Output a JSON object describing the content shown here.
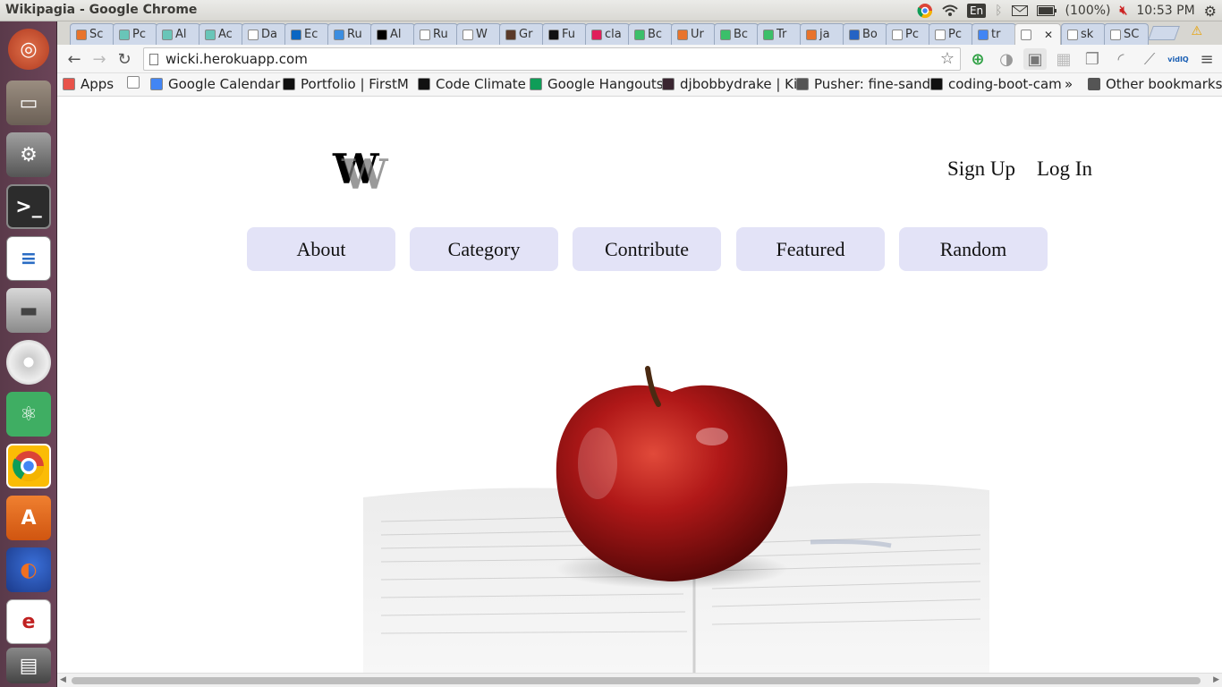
{
  "os": {
    "window_title": "Wikipagia - Google Chrome",
    "keyboard_lang": "En",
    "battery": "(100%)",
    "clock": "10:53 PM",
    "launcher_icons": [
      "ubuntu-dash-icon",
      "files-icon",
      "system-settings-icon",
      "terminal-icon",
      "libreoffice-writer-icon",
      "disk-icon",
      "dvd-icon",
      "atom-editor-icon",
      "chrome-icon",
      "software-center-icon",
      "firefox-icon",
      "document-viewer-icon",
      "trash-icon"
    ]
  },
  "tabs": [
    {
      "label": "Sc",
      "fav": "#e8732c"
    },
    {
      "label": "Pc",
      "fav": "#69c5b8"
    },
    {
      "label": "Al",
      "fav": "#69c5b8"
    },
    {
      "label": "Ac",
      "fav": "#69c5b8"
    },
    {
      "label": "Da",
      "fav": "#ffffff"
    },
    {
      "label": "Ec",
      "fav": "#0a66c2"
    },
    {
      "label": "Ru",
      "fav": "#3b8de0"
    },
    {
      "label": "Al",
      "fav": "#000000"
    },
    {
      "label": "Ru",
      "fav": "#ffffff"
    },
    {
      "label": "W",
      "fav": "#ffffff"
    },
    {
      "label": "Gr",
      "fav": "#5a3a2a"
    },
    {
      "label": "Fu",
      "fav": "#111111"
    },
    {
      "label": "cla",
      "fav": "#e01e5a"
    },
    {
      "label": "Bc",
      "fav": "#3bbf6a"
    },
    {
      "label": "Ur",
      "fav": "#e8732c"
    },
    {
      "label": "Bc",
      "fav": "#3bbf6a"
    },
    {
      "label": "Tr",
      "fav": "#3bbf6a"
    },
    {
      "label": "ja",
      "fav": "#e8732c"
    },
    {
      "label": "Bo",
      "fav": "#2563c4"
    },
    {
      "label": "Pc",
      "fav": "#ffffff"
    },
    {
      "label": "Pc",
      "fav": "#ffffff"
    },
    {
      "label": "tr",
      "fav": "#4285f4"
    },
    {
      "label": "",
      "fav": "#ffffff",
      "active": true
    },
    {
      "label": "sk",
      "fav": "#ffffff"
    },
    {
      "label": "SC",
      "fav": "#ffffff"
    }
  ],
  "browser": {
    "url": "wicki.herokuapp.com",
    "bookmarks": [
      {
        "label": "Apps",
        "color": "#e8534a"
      },
      {
        "label": "",
        "color": "#ffffff"
      },
      {
        "label": "Google Calendar",
        "color": "#4285f4"
      },
      {
        "label": "Portfolio | FirstM",
        "color": "#111111"
      },
      {
        "label": "Code Climate",
        "color": "#111111"
      },
      {
        "label": "Google Hangouts",
        "color": "#0f9d58"
      },
      {
        "label": "djbobbydrake | Ki",
        "color": "#3a2530"
      },
      {
        "label": "Pusher: fine-sand",
        "color": "#555555"
      },
      {
        "label": "coding-boot-cam",
        "color": "#111111"
      }
    ],
    "more_bookmarks": "»",
    "other_bookmarks": "Other bookmarks"
  },
  "page": {
    "logo_letter": "W",
    "auth": {
      "signup": "Sign Up",
      "login": "Log In"
    },
    "nav": [
      "About",
      "Category",
      "Contribute",
      "Featured",
      "Random"
    ]
  }
}
